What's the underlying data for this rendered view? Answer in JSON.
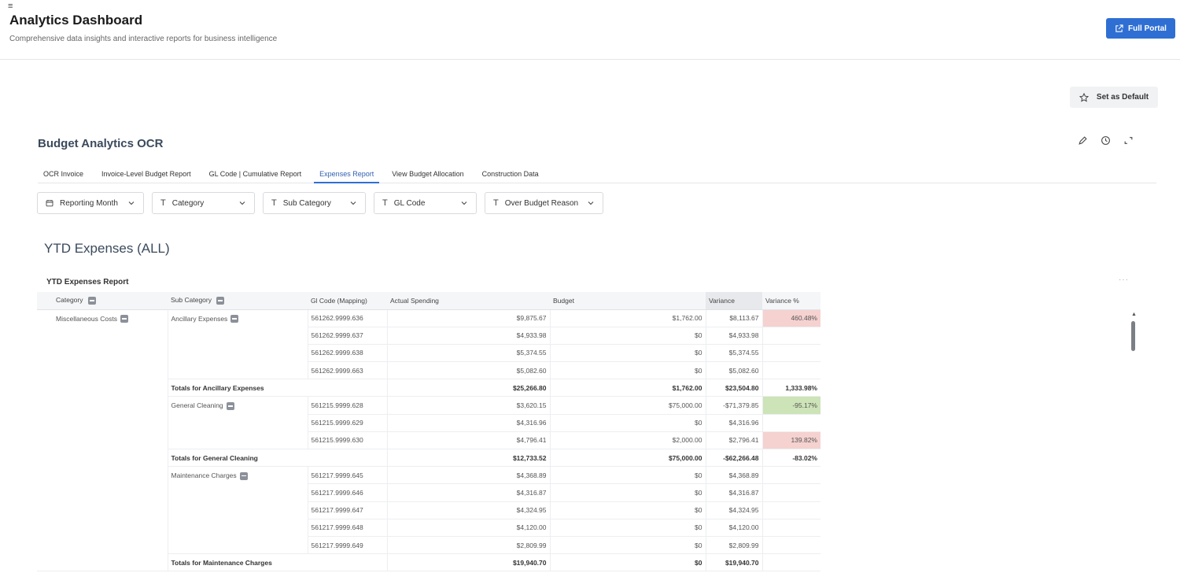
{
  "header": {
    "menu_icon": "hamburger-icon",
    "title": "Analytics Dashboard",
    "subtitle": "Comprehensive data insights and interactive reports for business intelligence",
    "full_portal_label": "Full Portal",
    "accent_color": "#2f6fd3"
  },
  "set_default_label": "Set as Default",
  "dashboard": {
    "title": "Budget Analytics OCR",
    "actions": [
      "edit-icon",
      "history-icon",
      "expand-icon"
    ]
  },
  "tabs": [
    {
      "label": "OCR Invoice",
      "active": false
    },
    {
      "label": "Invoice-Level Budget Report",
      "active": false
    },
    {
      "label": "GL Code | Cumulative Report",
      "active": false
    },
    {
      "label": "Expenses Report",
      "active": true
    },
    {
      "label": "View Budget Allocation",
      "active": false
    },
    {
      "label": "Construction Data",
      "active": false
    }
  ],
  "filters": [
    {
      "label": "Reporting Month",
      "icon": "calendar-icon"
    },
    {
      "label": "Category",
      "icon": "text-icon"
    },
    {
      "label": "Sub Category",
      "icon": "text-icon"
    },
    {
      "label": "GL Code",
      "icon": "text-icon"
    },
    {
      "label": "Over Budget Reason",
      "icon": "text-icon"
    }
  ],
  "section_title": "YTD Expenses (ALL)",
  "report": {
    "title": "YTD Expenses Report",
    "more_label": "···",
    "columns": [
      "Category",
      "Sub Category",
      "Gl Code (Mapping)",
      "Actual Spending",
      "Budget",
      "Variance",
      "Variance %"
    ],
    "category": "Miscellaneous Costs",
    "groups": [
      {
        "sub_category": "Ancillary Expenses",
        "rows": [
          {
            "gl": "561262.9999.636",
            "actual": "$9,875.67",
            "budget": "$1,762.00",
            "variance": "$8,113.67",
            "pct": "460.48%",
            "flag": "pos"
          },
          {
            "gl": "561262.9999.637",
            "actual": "$4,933.98",
            "budget": "$0",
            "variance": "$4,933.98",
            "pct": "",
            "flag": ""
          },
          {
            "gl": "561262.9999.638",
            "actual": "$5,374.55",
            "budget": "$0",
            "variance": "$5,374.55",
            "pct": "",
            "flag": ""
          },
          {
            "gl": "561262.9999.663",
            "actual": "$5,082.60",
            "budget": "$0",
            "variance": "$5,082.60",
            "pct": "",
            "flag": ""
          }
        ],
        "total": {
          "label": "Totals for Ancillary Expenses",
          "actual": "$25,266.80",
          "budget": "$1,762.00",
          "variance": "$23,504.80",
          "pct": "1,333.98%"
        }
      },
      {
        "sub_category": "General Cleaning",
        "rows": [
          {
            "gl": "561215.9999.628",
            "actual": "$3,620.15",
            "budget": "$75,000.00",
            "variance": "-$71,379.85",
            "pct": "-95.17%",
            "flag": "neg"
          },
          {
            "gl": "561215.9999.629",
            "actual": "$4,316.96",
            "budget": "$0",
            "variance": "$4,316.96",
            "pct": "",
            "flag": ""
          },
          {
            "gl": "561215.9999.630",
            "actual": "$4,796.41",
            "budget": "$2,000.00",
            "variance": "$2,796.41",
            "pct": "139.82%",
            "flag": "pos"
          }
        ],
        "total": {
          "label": "Totals for General Cleaning",
          "actual": "$12,733.52",
          "budget": "$75,000.00",
          "variance": "-$62,266.48",
          "pct": "-83.02%"
        }
      },
      {
        "sub_category": "Maintenance Charges",
        "rows": [
          {
            "gl": "561217.9999.645",
            "actual": "$4,368.89",
            "budget": "$0",
            "variance": "$4,368.89",
            "pct": "",
            "flag": ""
          },
          {
            "gl": "561217.9999.646",
            "actual": "$4,316.87",
            "budget": "$0",
            "variance": "$4,316.87",
            "pct": "",
            "flag": ""
          },
          {
            "gl": "561217.9999.647",
            "actual": "$4,324.95",
            "budget": "$0",
            "variance": "$4,324.95",
            "pct": "",
            "flag": ""
          },
          {
            "gl": "561217.9999.648",
            "actual": "$4,120.00",
            "budget": "$0",
            "variance": "$4,120.00",
            "pct": "",
            "flag": ""
          },
          {
            "gl": "561217.9999.649",
            "actual": "$2,809.99",
            "budget": "$0",
            "variance": "$2,809.99",
            "pct": "",
            "flag": ""
          }
        ],
        "total": {
          "label": "Totals for Maintenance Charges",
          "actual": "$19,940.70",
          "budget": "$0",
          "variance": "$19,940.70",
          "pct": ""
        }
      }
    ]
  }
}
